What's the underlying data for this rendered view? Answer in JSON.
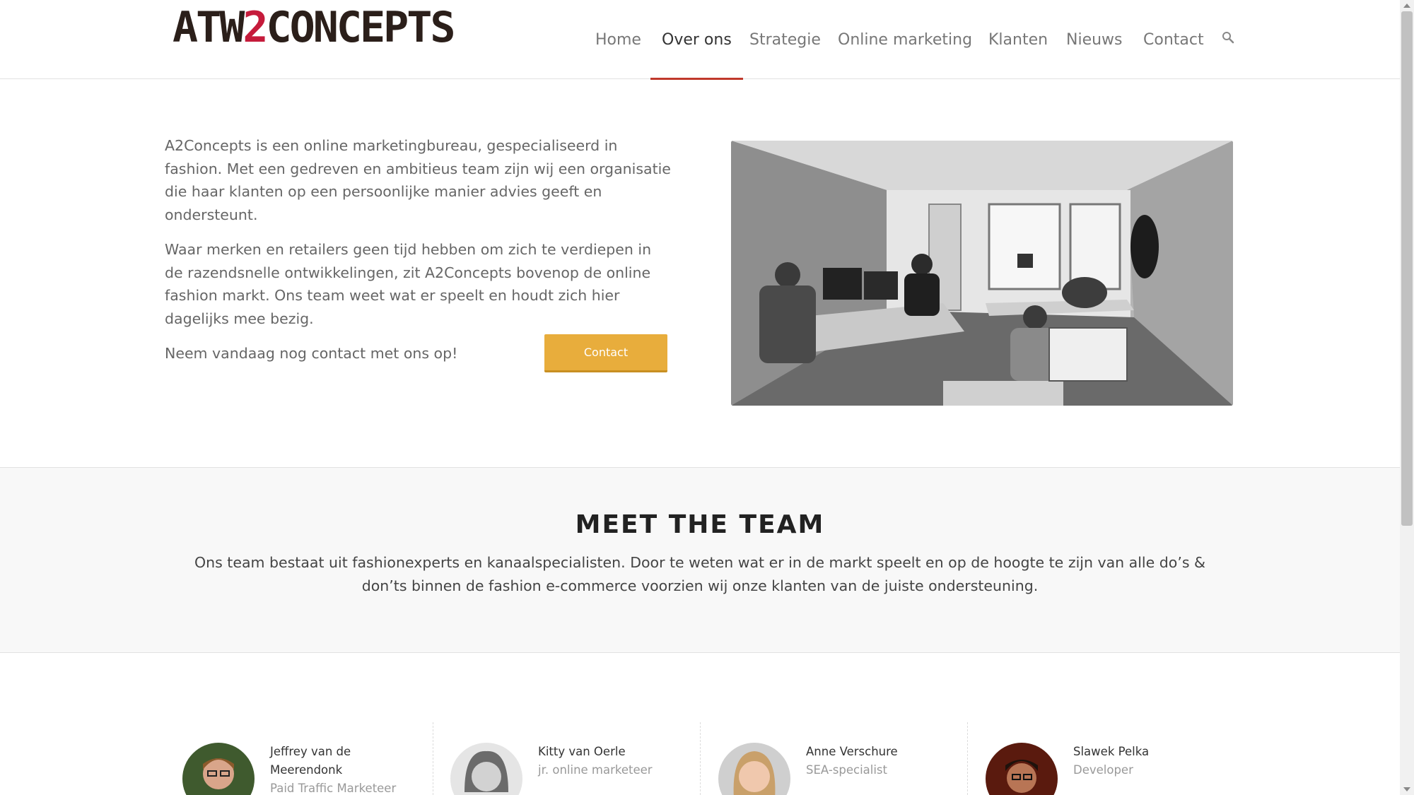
{
  "header": {
    "logo_text_a": "ATW",
    "logo_text_two": "2",
    "logo_text_b": "CONCEPTS",
    "nav": [
      {
        "label": "Home",
        "active": false
      },
      {
        "label": "Over ons",
        "active": true
      },
      {
        "label": "Strategie",
        "active": false
      },
      {
        "label": "Online marketing",
        "active": false
      },
      {
        "label": "Klanten",
        "active": false
      },
      {
        "label": "Nieuws",
        "active": false
      },
      {
        "label": "Contact",
        "active": false
      }
    ],
    "search_icon": "search-icon"
  },
  "intro": {
    "paragraphs": [
      "A2Concepts is een online marketingbureau, gespecialiseerd in fashion. Met een gedreven en ambitieus team zijn wij een organisatie die haar klanten op een persoonlijke manier advies geeft en ondersteunt.",
      "Waar merken en retailers geen tijd hebben om zich te verdiepen in de razendsnelle ontwikkelingen, zit A2Concepts bovenop de online fashion markt. Ons team weet wat er speelt en houdt zich hier dagelijks mee bezig.",
      "Neem vandaag nog contact met ons op!"
    ],
    "contact_button": "Contact",
    "photo_icon": "office-photo"
  },
  "team": {
    "title": "MEET THE TEAM",
    "description": "Ons team bestaat uit fashionexperts en kanaalspecialisten. Door te weten wat er in de markt speelt en op de hoogte te zijn van alle do’s & don’ts binnen de fashion e-commerce voorzien wij onze klanten van de juiste ondersteuning.",
    "members": [
      {
        "name": "Jeffrey van de Meerendonk",
        "role": "Paid Traffic Marketeer"
      },
      {
        "name": "Kitty van Oerle",
        "role": "jr. online marketeer"
      },
      {
        "name": "Anne Verschure",
        "role": "SEA-specialist"
      },
      {
        "name": "Slawek Pelka",
        "role": "Developer"
      }
    ]
  },
  "colors": {
    "accent_red": "#c0392b",
    "logo_red": "#c51b3b",
    "button_orange": "#e8ad3c"
  }
}
